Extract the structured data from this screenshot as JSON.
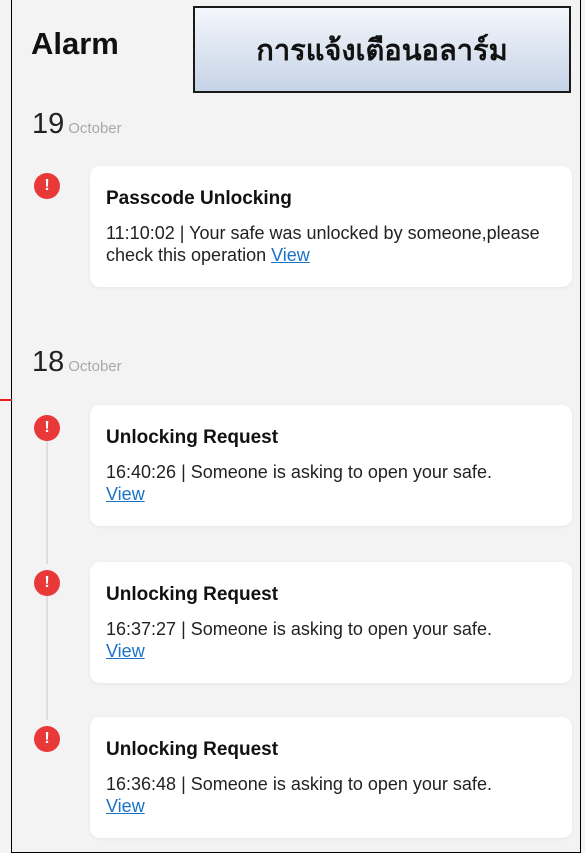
{
  "header": {
    "title": "Alarm",
    "banner_text": "การแจ้งเตือนอลาร์ม"
  },
  "groups": [
    {
      "day": "19",
      "month": "October",
      "items": [
        {
          "title": "Passcode Unlocking",
          "time": "11:10:02",
          "message": "Your safe was unlocked by someone,please check this operation",
          "link": "View"
        }
      ]
    },
    {
      "day": "18",
      "month": "October",
      "items": [
        {
          "title": "Unlocking Request",
          "time": "16:40:26",
          "message": "Someone is asking to open your safe.",
          "link": "View"
        },
        {
          "title": "Unlocking Request",
          "time": "16:37:27",
          "message": "Someone is asking to open your safe.",
          "link": "View"
        },
        {
          "title": "Unlocking Request",
          "time": "16:36:48",
          "message": "Someone is asking to open your safe.",
          "link": "View"
        }
      ]
    }
  ],
  "alert_icon_glyph": "!",
  "colors": {
    "alert": "#e83838",
    "link": "#1a73c8",
    "background": "#f3f3f3"
  }
}
